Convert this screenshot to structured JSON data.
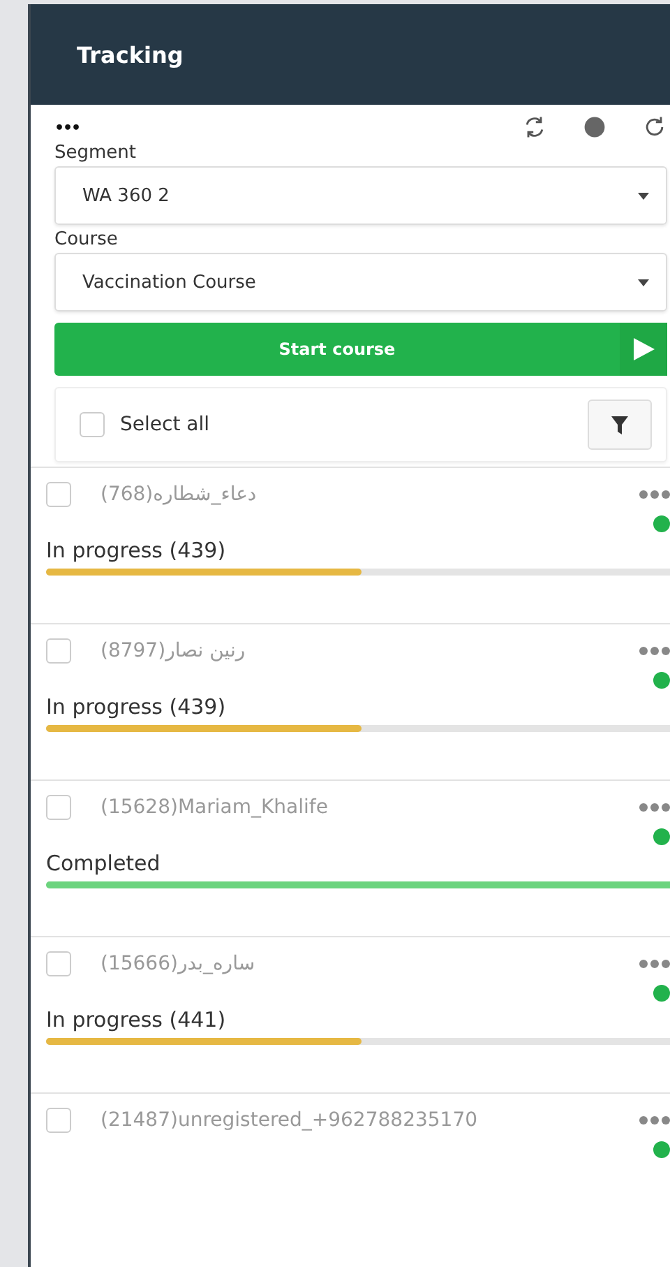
{
  "header": {
    "title": "Tracking"
  },
  "toolbar": {
    "menu": "•••"
  },
  "segment": {
    "label": "Segment",
    "value": "WA 360 2"
  },
  "course": {
    "label": "Course",
    "value": "Vaccination Course"
  },
  "start_button": {
    "label": "Start course"
  },
  "select_all": {
    "label": "Select all",
    "checked": false
  },
  "rows": [
    {
      "name": "(768)دعاء_شطاره",
      "checked": false,
      "online": true,
      "progress": {
        "kind": "in_progress",
        "label": "In progress (439)",
        "level": 0.5
      }
    },
    {
      "name": "(8797)رنين نصار",
      "checked": false,
      "online": true,
      "progress": {
        "kind": "in_progress",
        "label": "In progress (439)",
        "level": 0.5
      }
    },
    {
      "name": "(15628)Mariam_Khalife",
      "checked": false,
      "online": true,
      "progress": {
        "kind": "completed",
        "label": "Completed",
        "level": 1
      }
    },
    {
      "name": "(15666)ساره_بدر",
      "checked": false,
      "online": true,
      "progress": {
        "kind": "in_progress",
        "label": "In progress (441)",
        "level": 0.5
      }
    },
    {
      "name": "(21487)unregistered_+962788235170",
      "checked": false,
      "online": true
    }
  ]
}
